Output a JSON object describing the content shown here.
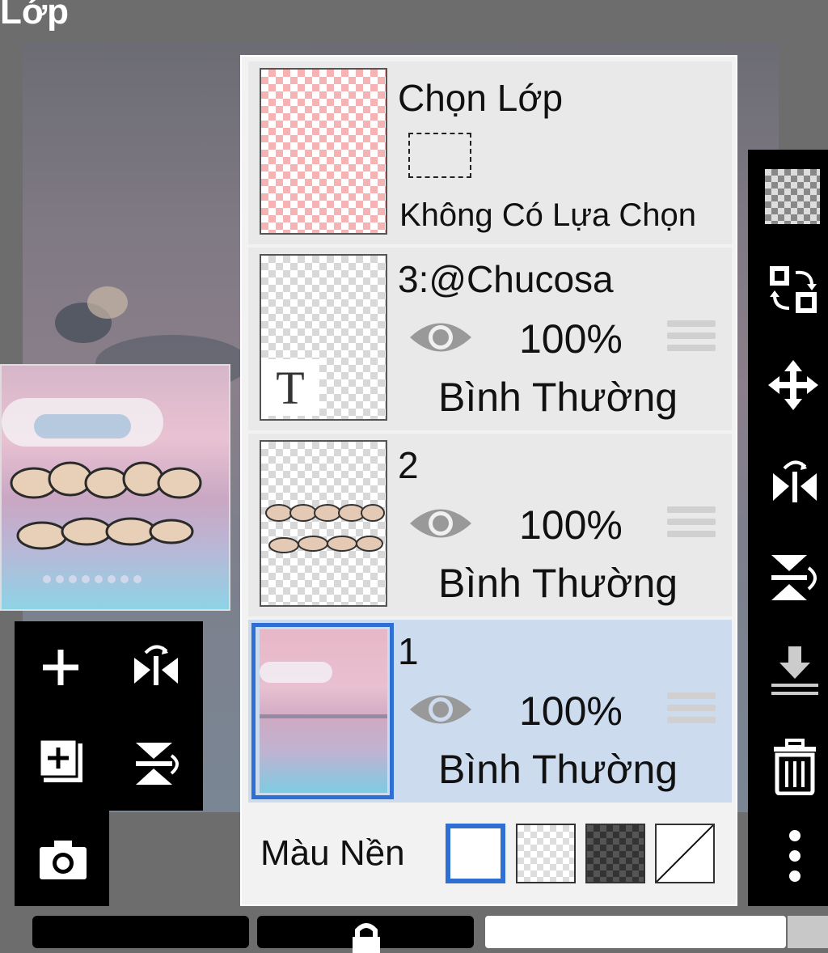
{
  "title": "Lớp",
  "selection_row": {
    "title": "Chọn Lớp",
    "status": "Không Có Lựa Chọn"
  },
  "layers": [
    {
      "name": "3:@Chucosa",
      "opacity": "100%",
      "blend": "Bình Thường",
      "visible": true,
      "selected": false,
      "text_badge": "T"
    },
    {
      "name": "2",
      "opacity": "100%",
      "blend": "Bình Thường",
      "visible": true,
      "selected": false
    },
    {
      "name": "1",
      "opacity": "100%",
      "blend": "Bình Thường",
      "visible": true,
      "selected": true
    }
  ],
  "background": {
    "label": "Màu Nền",
    "options": [
      "white",
      "transparent-light",
      "transparent-dark",
      "none"
    ],
    "selected": "white"
  },
  "left_tools": [
    "add-layer-icon",
    "flip-horizontal-icon",
    "duplicate-layer-icon",
    "flip-vertical-icon",
    "camera-icon"
  ],
  "right_tools": [
    "transparency-icon",
    "swap-icon",
    "move-icon",
    "flip-horizontal-icon",
    "flip-vertical-icon",
    "merge-down-icon",
    "trash-icon",
    "more-icon"
  ],
  "colors": {
    "accent": "#2f6fd4",
    "selected_row": "#cddbef",
    "panel": "#f2f2f2",
    "toolbar": "#000000"
  }
}
